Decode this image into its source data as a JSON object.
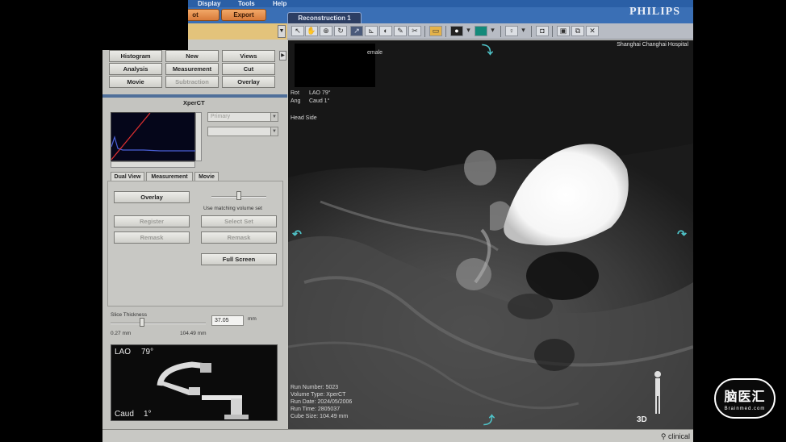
{
  "menu": {
    "display": "Display",
    "tools": "Tools",
    "help": "Help"
  },
  "top_buttons": {
    "left_partial": "ot",
    "export": "Export"
  },
  "tab": {
    "reconstruction": "Reconstruction 1"
  },
  "brand": "PHILIPS",
  "tool_buttons": [
    {
      "label": "Histogram"
    },
    {
      "label": "New"
    },
    {
      "label": "Views"
    },
    {
      "label": "Analysis"
    },
    {
      "label": "Measurement"
    },
    {
      "label": "Cut"
    },
    {
      "label": "Movie"
    },
    {
      "label": "Subtraction"
    },
    {
      "label": "Overlay"
    }
  ],
  "panel": {
    "title": "XperCT",
    "primary_select": "Primary",
    "secondary_select": "",
    "tabs": [
      "Dual View",
      "Measurement",
      "Movie"
    ],
    "overlay_button": "Overlay",
    "use_matching": "Use matching volume set",
    "register_button": "Register",
    "select_set_button": "Select Set",
    "remask_button_1": "Remask",
    "remask_button_2": "Remask",
    "full_screen_button": "Full Screen",
    "slice_thickness_label": "Slice Thickness",
    "slice_thickness_value": "37.05",
    "slice_unit": "mm",
    "slice_min": "0.27 mm",
    "slice_max": "104.49 mm",
    "blend_level": 0.5,
    "slice_level": 0.33
  },
  "thumbnail": {
    "angle1_name": "LAO",
    "angle1_value": "79°",
    "angle2_name": "Caud",
    "angle2_value": "1°"
  },
  "viewport": {
    "hospital": "Shanghai Changhai Hospital",
    "partial_text": "emale",
    "rot_label": "Rot",
    "rot_value": "LAO 79°",
    "ang_label": "Ang",
    "ang_value": "Caud 1°",
    "orientation": "Head Side",
    "run_info": [
      "Run Number:  5023",
      "Volume Type:  XperCT",
      "Run Date:  2024/05/2006",
      "Run Time:  2805037",
      "Cube Size:  104.49 mm"
    ],
    "label_3d": "3D"
  },
  "status": {
    "user": "clinical"
  },
  "watermark": {
    "cn": "脑医汇",
    "en": "Brainmed.com"
  }
}
